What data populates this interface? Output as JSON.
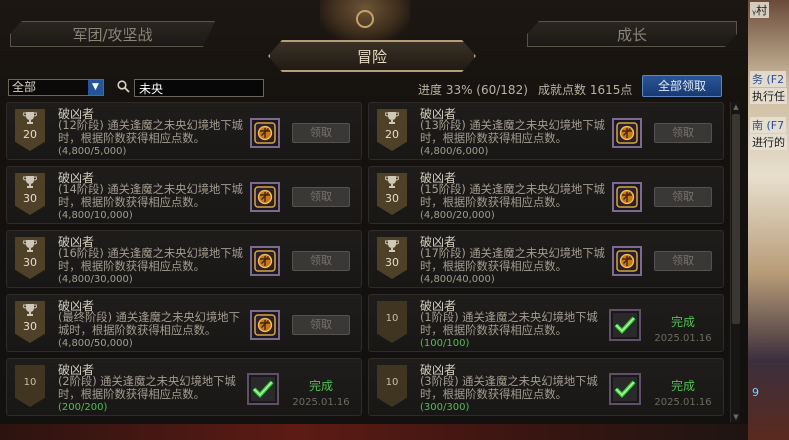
{
  "header": {
    "tab_left": "军团/攻坚战",
    "tab_center": "冒险",
    "tab_right": "成长"
  },
  "filter": {
    "category_selected": "全部",
    "search_value": "未央",
    "progress": "进度  33% (60/182)",
    "points": "成就点数 1615点",
    "claim_all": "全部领取"
  },
  "achievements": [
    {
      "title": "破凶者",
      "points": "20",
      "desc": "(12阶段) 通关逢魔之未央幻境地下城时，根据阶数获得相应点数。",
      "progress": "(4,800/5,000)",
      "claim": "领取"
    },
    {
      "title": "破凶者",
      "points": "20",
      "desc": "(13阶段) 通关逢魔之未央幻境地下城时，根据阶数获得相应点数。",
      "progress": "(4,800/6,000)",
      "claim": "领取"
    },
    {
      "title": "破凶者",
      "points": "30",
      "desc": "(14阶段) 通关逢魔之未央幻境地下城时，根据阶数获得相应点数。",
      "progress": "(4,800/10,000)",
      "claim": "领取"
    },
    {
      "title": "破凶者",
      "points": "30",
      "desc": "(15阶段) 通关逢魔之未央幻境地下城时，根据阶数获得相应点数。",
      "progress": "(4,800/20,000)",
      "claim": "领取"
    },
    {
      "title": "破凶者",
      "points": "30",
      "desc": "(16阶段) 通关逢魔之未央幻境地下城时，根据阶数获得相应点数。",
      "progress": "(4,800/30,000)",
      "claim": "领取"
    },
    {
      "title": "破凶者",
      "points": "30",
      "desc": "(17阶段) 通关逢魔之未央幻境地下城时，根据阶数获得相应点数。",
      "progress": "(4,800/40,000)",
      "claim": "领取"
    },
    {
      "title": "破凶者",
      "points": "30",
      "desc": "(最终阶段) 通关逢魔之未央幻境地下城时，根据阶数获得相应点数。",
      "progress": "(4,800/50,000)",
      "claim": "领取"
    },
    {
      "title": "破凶者",
      "points": "10",
      "desc": "(1阶段) 通关逢魔之未央幻境地下城时，根据阶数获得相应点数。",
      "progress": "(100/100)",
      "status": "完成",
      "date": "2025.01.16"
    },
    {
      "title": "破凶者",
      "points": "10",
      "desc": "(2阶段) 通关逢魔之未央幻境地下城时，根据阶数获得相应点数。",
      "progress": "(200/200)",
      "status": "完成",
      "date": "2025.01.16"
    },
    {
      "title": "破凶者",
      "points": "10",
      "desc": "(3阶段) 通关逢魔之未央幻境地下城时，根据阶数获得相应点数。",
      "progress": "(300/300)",
      "status": "完成",
      "date": "2025.01.16"
    }
  ],
  "backdrop": {
    "line1": "ᵧ村",
    "line2": "务 (F2",
    "line3": "执行任",
    "line4": "南 (F7",
    "line5": "进行的",
    "line6": "9"
  },
  "colors": {
    "accent_blue": "#24549a",
    "complete_green": "#4fbf53"
  }
}
